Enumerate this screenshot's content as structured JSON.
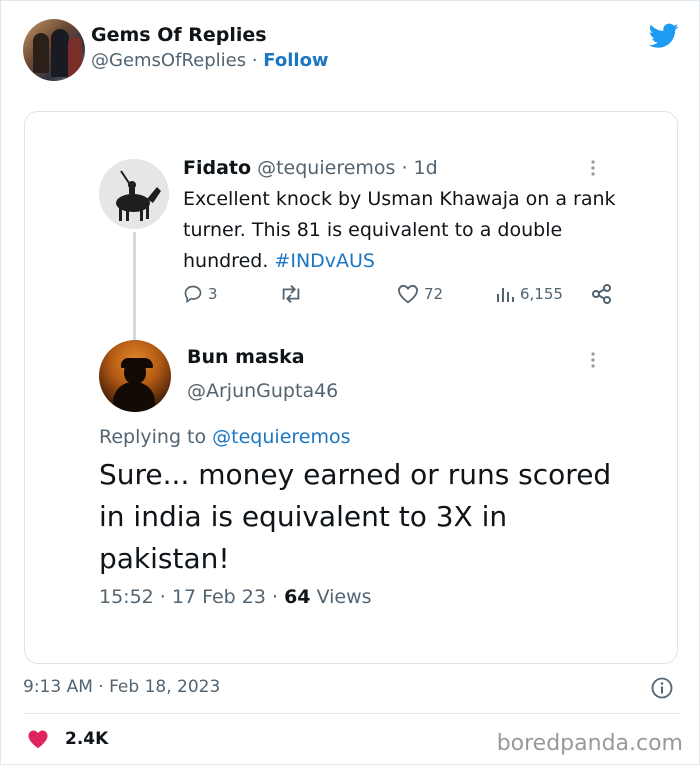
{
  "author": {
    "name": "Gems Of Replies",
    "handle": "@GemsOfReplies",
    "separator": "·",
    "follow_label": "Follow"
  },
  "quoted_tweet": {
    "name": "Fidato",
    "handle_time": "@tequieremos · 1d",
    "text": "Excellent knock by Usman Khawaja on a rank turner. This 81 is equivalent to a double hundred.",
    "hashtag": "#INDvAUS",
    "replies": "3",
    "likes": "72",
    "views": "6,155"
  },
  "reply_tweet": {
    "name": "Bun maska",
    "handle": "@ArjunGupta46",
    "replying_prefix": "Replying to",
    "replying_to": "@tequieremos",
    "text": "Sure... money earned or runs scored in india is equivalent to 3X in pakistan!",
    "timestamp": "15:52 · 17 Feb 23 ·",
    "views_count": "64",
    "views_label": "Views"
  },
  "footer": {
    "post_time": "9:13 AM · Feb 18, 2023",
    "like_count": "2.4K",
    "watermark": "boredpanda.com"
  },
  "colors": {
    "link": "#1d76c2",
    "heart": "#e0245e",
    "twitter": "#1d9bf0"
  }
}
